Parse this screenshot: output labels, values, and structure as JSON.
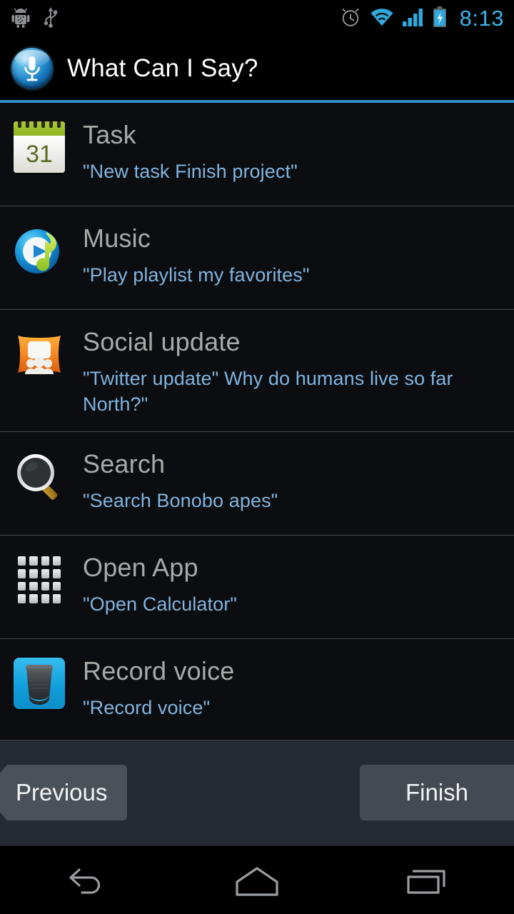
{
  "statusbar": {
    "time": "8:13",
    "left_icons": [
      {
        "name": "android-debug-icon",
        "label": "Android debugging"
      },
      {
        "name": "usb-icon",
        "label": "USB connected"
      }
    ],
    "right_icons": [
      {
        "name": "alarm-clock-icon",
        "label": "Alarm set"
      },
      {
        "name": "wifi-icon",
        "label": "Wi-Fi signal"
      },
      {
        "name": "cellular-signal-icon",
        "label": "Cellular signal"
      },
      {
        "name": "battery-charging-icon",
        "label": "Battery charging"
      }
    ],
    "accent_color": "#3cb4e8"
  },
  "header": {
    "title": "What Can I Say?",
    "icon": "microphone-icon",
    "accent_color": "#2c8fc9",
    "title_color": "#ffffff"
  },
  "list": {
    "title_color": "#a9aaa8",
    "subtitle_color": "#82b4de",
    "items": [
      {
        "icon": "calendar-icon",
        "icon_day": "31",
        "title": "Task",
        "example": "\"New task Finish project\""
      },
      {
        "icon": "music-note-play-icon",
        "title": "Music",
        "example": "\"Play playlist my favorites\""
      },
      {
        "icon": "social-people-bubble-icon",
        "title": "Social update",
        "example": "\"Twitter update\" Why do humans live so far North?\""
      },
      {
        "icon": "magnifier-icon",
        "title": "Search",
        "example": "\"Search Bonobo apes\""
      },
      {
        "icon": "app-grid-icon",
        "title": "Open App",
        "example": "\"Open Calculator\""
      },
      {
        "icon": "voice-recorder-icon",
        "title": "Record voice",
        "example": "\"Record voice\""
      }
    ]
  },
  "footer": {
    "previous_label": "Previous",
    "finish_label": "Finish",
    "background": "#262b33"
  },
  "navbar": {
    "buttons": [
      {
        "name": "back-icon",
        "label": "Back"
      },
      {
        "name": "home-icon",
        "label": "Home"
      },
      {
        "name": "recents-icon",
        "label": "Recent apps"
      }
    ]
  }
}
